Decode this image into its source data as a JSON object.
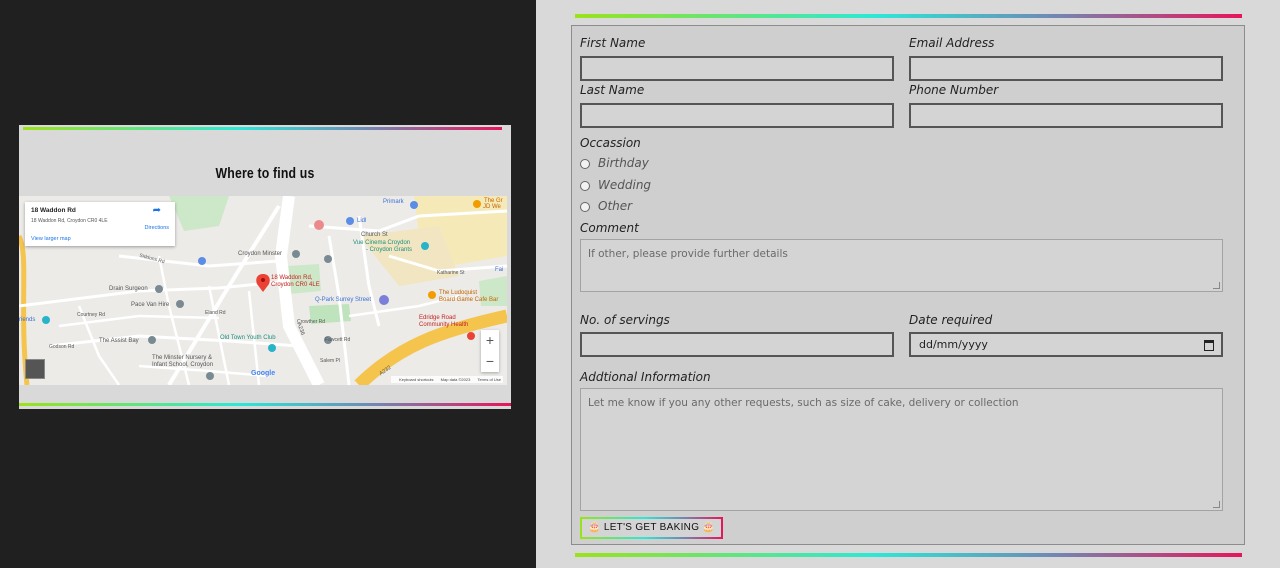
{
  "map_section": {
    "title": "Where to find us",
    "infobox": {
      "place_name": "18 Waddon Rd",
      "address": "18 Waddon Rd, Croydon CR0 4LE",
      "directions_label": "Directions",
      "larger_map_link": "View larger map"
    },
    "pin_label_line1": "18 Waddon Rd,",
    "pin_label_line2": "Croydon CR0 4LE",
    "labels": {
      "primark": "Primark",
      "lidl": "Lidl",
      "church_st": "Church St",
      "vue_cinema_line1": "Vue Cinema Croydon",
      "vue_cinema_line2": "- Croydon Grants",
      "croydon_minster": "Croydon Minster",
      "katharine_st": "Katharine St",
      "siddons_rd": "Siddons Rd",
      "drain_surgeon": "Drain Surgeon",
      "pace_van_hire": "Pace Van Hire",
      "elland_rd": "Eland Rd",
      "qpark": "Q-Park Surrey Street",
      "ludoquist_line1": "The Ludoquist",
      "ludoquist_line2": "Board Game Cafe Bar",
      "crowther_rd": "Crowther Rd",
      "old_town_youth_club": "Old Town Youth Club",
      "the_assist_bay": "The Assist Bay",
      "fawcett_rd": "Fawcett Rd",
      "eridge_line1": "Edridge Road",
      "eridge_line2": "Community Health",
      "minster_line1": "The Minster Nursery &",
      "minster_line2": "Infant School, Croydon",
      "salem_pl": "Salem Pl",
      "godson_rd": "Godson Rd",
      "courtney_rd": "Courtney Rd",
      "a236": "A236",
      "a232": "A232",
      "the_gr_line1": "The Gr",
      "the_gr_line2": "JD We",
      "fai": "Fai",
      "friends": "riends"
    },
    "zoom_in": "+",
    "zoom_out": "−",
    "google_logo": "Google",
    "footer": {
      "keyboard": "Keyboard shortcuts",
      "map_data": "Map data ©2023",
      "terms": "Terms of Use"
    }
  },
  "form": {
    "first_name_label": "First Name",
    "email_label": "Email Address",
    "last_name_label": "Last Name",
    "phone_label": "Phone Number",
    "occasion_label": "Occassion",
    "occasion_options": [
      "Birthday",
      "Wedding",
      "Other"
    ],
    "comment_label": "Comment",
    "comment_placeholder": "If other, please provide further details",
    "servings_label": "No. of servings",
    "date_label": "Date required",
    "date_placeholder": "dd/mm/yyyy",
    "additional_label": "Addtional Information",
    "additional_placeholder": "Let me know if you any other requests, such as size of cake, delivery or collection",
    "submit_label": "🎂 LET'S GET BAKING 🎂"
  },
  "colors": {
    "page_bg": "#202020",
    "panel_bg": "#d9d9d9",
    "gradient_start": "#9be21a",
    "gradient_mid": "#2ce8d6",
    "gradient_end": "#e8145a"
  }
}
